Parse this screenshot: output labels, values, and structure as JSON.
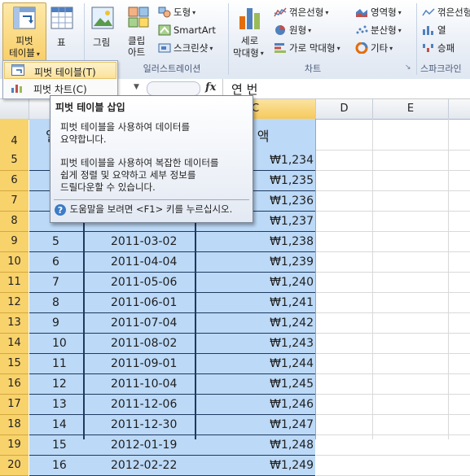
{
  "ribbon": {
    "pivot_label_1": "피벗",
    "pivot_label_2": "테이블",
    "table_label": "표",
    "picture_label": "그림",
    "clipart_label_1": "클립",
    "clipart_label_2": "아트",
    "shapes_label": "도형",
    "smartart_label": "SmartArt",
    "screenshot_label": "스크린샷",
    "illustrations_group": "일러스트레이션",
    "column_label_1": "세로",
    "column_label_2": "막대형",
    "line_label": "꺾은선형",
    "pie_label": "원형",
    "bar_label": "가로 막대형",
    "area_label": "영역형",
    "scatter_label": "분산형",
    "other_label": "기타",
    "charts_group": "차트",
    "sparkline_line": "꺾은선형",
    "sparkline_column": "열",
    "sparkline_winloss": "승패",
    "sparklines_group": "스파크라인"
  },
  "menu": {
    "pivot_table": "피벗 테이블(T)",
    "pivot_chart": "피벗 차트(C)"
  },
  "formula_bar": {
    "fx": "fx",
    "content": "연 번"
  },
  "columns": [
    "C",
    "D",
    "E"
  ],
  "header_row": {
    "row": "4",
    "col_a_partial": "일",
    "col_c_partial": "금 액"
  },
  "rows": [
    {
      "row": "5",
      "no": "",
      "date": "",
      "amount": "₩1,234"
    },
    {
      "row": "6",
      "no": "",
      "date": "",
      "amount": "₩1,235"
    },
    {
      "row": "7",
      "no": "",
      "date": "",
      "amount": "₩1,236"
    },
    {
      "row": "8",
      "no": "",
      "date": "",
      "amount": "₩1,237"
    },
    {
      "row": "9",
      "no": "5",
      "date": "2011-03-02",
      "amount": "₩1,238"
    },
    {
      "row": "10",
      "no": "6",
      "date": "2011-04-04",
      "amount": "₩1,239"
    },
    {
      "row": "11",
      "no": "7",
      "date": "2011-05-06",
      "amount": "₩1,240"
    },
    {
      "row": "12",
      "no": "8",
      "date": "2011-06-01",
      "amount": "₩1,241"
    },
    {
      "row": "13",
      "no": "9",
      "date": "2011-07-04",
      "amount": "₩1,242"
    },
    {
      "row": "14",
      "no": "10",
      "date": "2011-08-02",
      "amount": "₩1,243"
    },
    {
      "row": "15",
      "no": "11",
      "date": "2011-09-01",
      "amount": "₩1,244"
    },
    {
      "row": "16",
      "no": "12",
      "date": "2011-10-04",
      "amount": "₩1,245"
    },
    {
      "row": "17",
      "no": "13",
      "date": "2011-12-06",
      "amount": "₩1,246"
    },
    {
      "row": "18",
      "no": "14",
      "date": "2011-12-30",
      "amount": "₩1,247"
    },
    {
      "row": "19",
      "no": "15",
      "date": "2012-01-19",
      "amount": "₩1,248"
    },
    {
      "row": "20",
      "no": "16",
      "date": "2012-02-22",
      "amount": "₩1,249"
    }
  ],
  "tooltip": {
    "title": "피벗 테이블 삽입",
    "para1_line1": "피벗 테이블을 사용하여 데이터를",
    "para1_line2": "요약합니다.",
    "para2_line1": "피벗 테이블을 사용하여 복잡한 데이터를",
    "para2_line2": "쉽게 정렬 및 요약하고 세부 정보를",
    "para2_line3": "드릴다운할 수 있습니다.",
    "help": "도움말을 보려면 <F1> 키를 누르십시오."
  },
  "colors": {
    "table_fill": "#bcd9f7",
    "row_header_selected": "#f8d26b",
    "border_dark": "#1f3a5f"
  }
}
